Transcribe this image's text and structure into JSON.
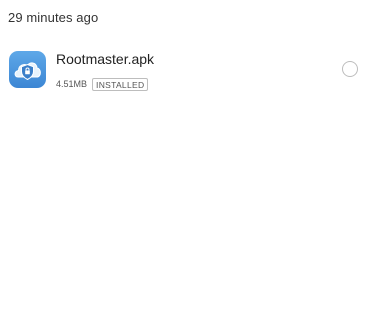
{
  "section": {
    "header": "29 minutes ago"
  },
  "files": [
    {
      "name": "Rootmaster.apk",
      "size": "4.51MB",
      "status": "INSTALLED",
      "icon": "rootmaster-app-icon",
      "selected": false
    }
  ],
  "colors": {
    "icon_bg": "#4a96de",
    "badge_border": "#bdbdbd",
    "radio_border": "#bdbdbd"
  }
}
